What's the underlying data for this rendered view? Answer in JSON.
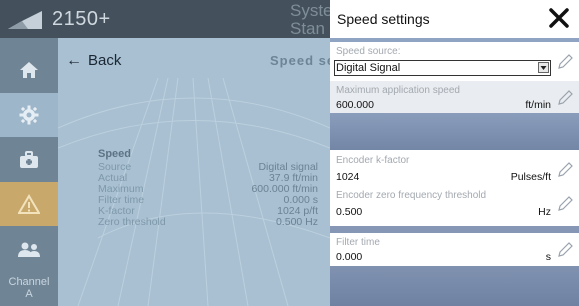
{
  "app": {
    "logo_text": "2150+",
    "header_partial_line1": "Syste",
    "header_partial_line2": "Stan"
  },
  "sidebar": {
    "items": [
      {
        "name": "home"
      },
      {
        "name": "settings"
      },
      {
        "name": "toolbox"
      },
      {
        "name": "warning"
      },
      {
        "name": "users"
      },
      {
        "label_line1": "Channel",
        "label_line2": "A"
      }
    ]
  },
  "content": {
    "back_label": "Back",
    "title_partial": "Speed se",
    "speed": {
      "heading": "Speed",
      "rows": [
        {
          "label": "Source",
          "value": "Digital signal"
        },
        {
          "label": "Actual",
          "value": "37.9 ft/min"
        },
        {
          "label": "Maximum",
          "value": "600.000 ft/min"
        },
        {
          "label": "Filter time",
          "value": "0.000 s"
        },
        {
          "label": "K-factor",
          "value": "1024 p/ft"
        },
        {
          "label": "Zero threshold",
          "value": "0.500 Hz"
        }
      ]
    }
  },
  "modal": {
    "title": "Speed settings",
    "fields": {
      "speed_source": {
        "label": "Speed source:",
        "value": "Digital Signal"
      },
      "max_speed": {
        "label": "Maximum application speed",
        "value": "600.000",
        "unit": "ft/min"
      },
      "k_factor": {
        "label": "Encoder k-factor",
        "value": "1024",
        "unit": "Pulses/ft"
      },
      "zero_threshold": {
        "label": "Encoder zero frequency threshold",
        "value": "0.500",
        "unit": "Hz"
      },
      "filter_time": {
        "label": "Filter time",
        "value": "0.000",
        "unit": "s"
      }
    }
  },
  "colors": {
    "topbar": "#44515d",
    "sidebar": "#6f8494",
    "content_bg": "#a8c0d2",
    "modal_backdrop": "#7f90ad",
    "warning_item": "#c9a86c"
  }
}
